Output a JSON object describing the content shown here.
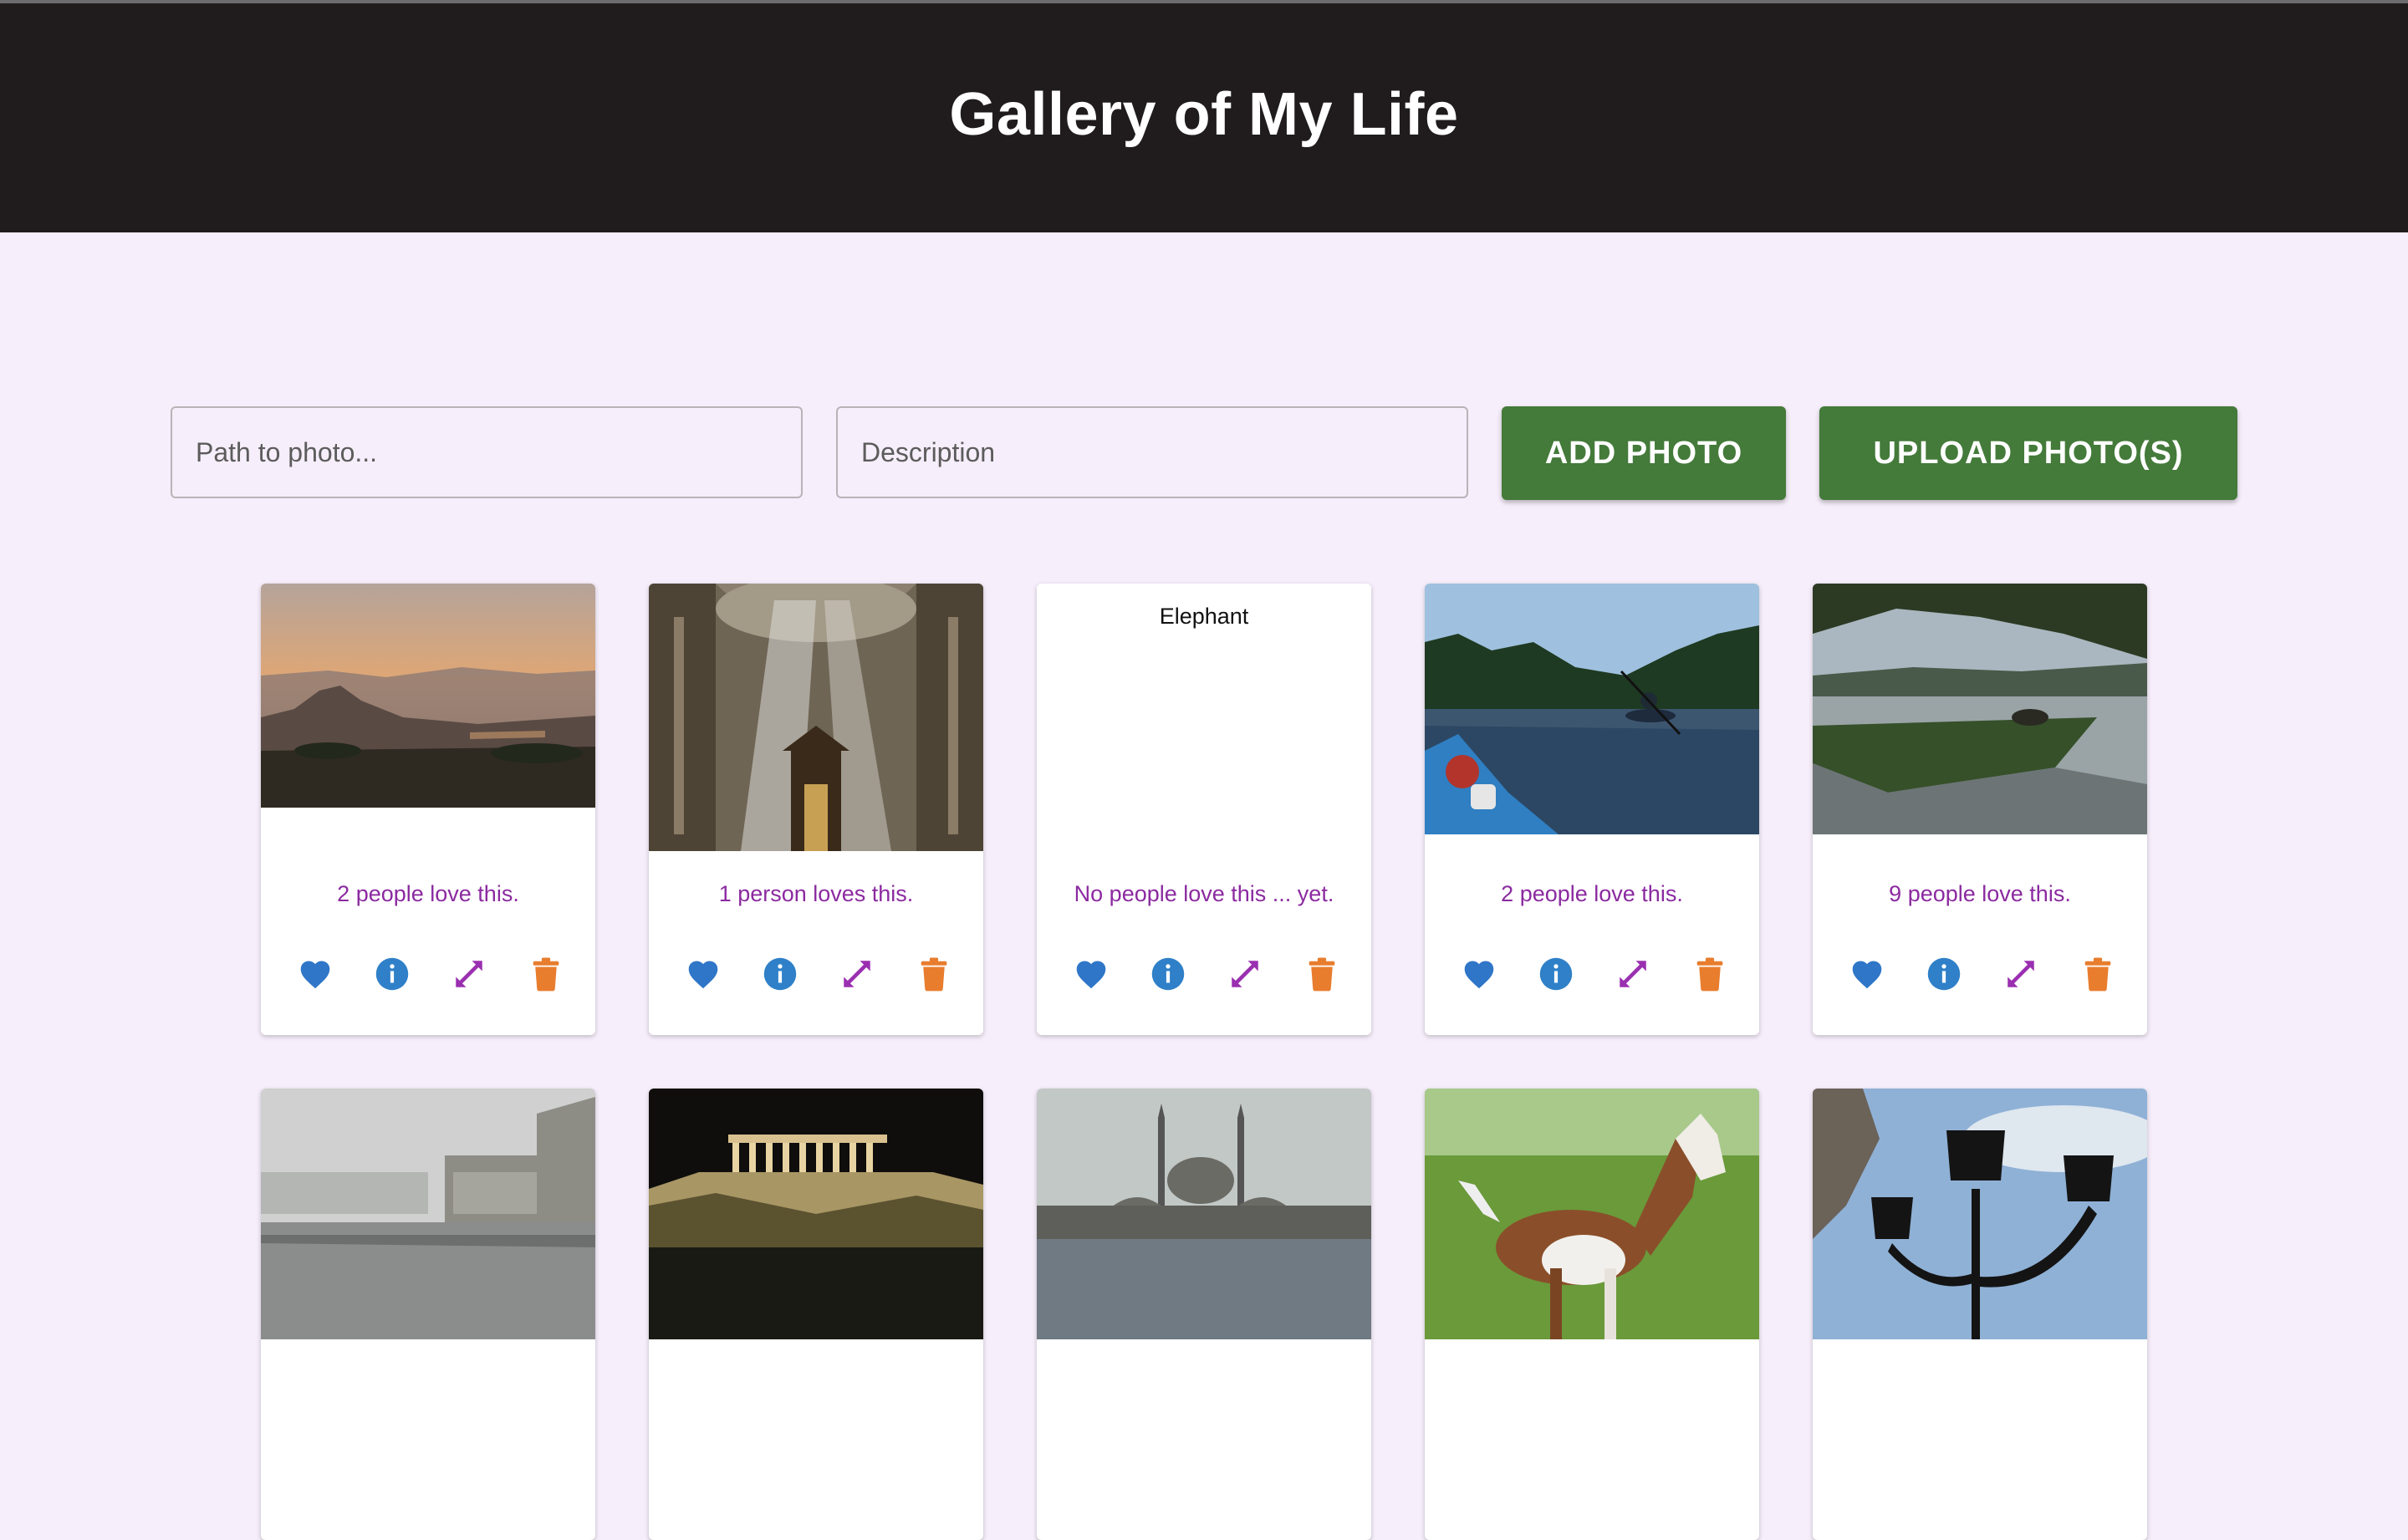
{
  "app": {
    "title": "Gallery of My Life"
  },
  "form": {
    "path_placeholder": "Path to photo...",
    "description_placeholder": "Description",
    "add_label": "ADD PHOTO",
    "upload_label": "UPLOAD PHOTO(S)"
  },
  "colors": {
    "header_bg": "#201c1d",
    "page_bg": "#f6eefa",
    "button_green": "#447a3a",
    "love_text": "#8b2aa0",
    "heart_blue": "#2f76c8",
    "info_blue": "#2f80c8",
    "expand_purple": "#9a2fb0",
    "trash_orange": "#e87d2e"
  },
  "cards": [
    {
      "love": "2 people love this.",
      "icons": [
        "heart-icon",
        "info-icon",
        "expand-icon",
        "trash-icon"
      ]
    },
    {
      "love": "1 person loves this.",
      "icons": [
        "heart-icon",
        "info-icon",
        "expand-icon",
        "trash-icon"
      ]
    },
    {
      "alt": "Elephant",
      "love": "No people love this ... yet.",
      "icons": [
        "heart-icon",
        "info-icon",
        "expand-icon",
        "trash-icon"
      ]
    },
    {
      "love": "2 people love this.",
      "icons": [
        "heart-icon",
        "info-icon",
        "expand-icon",
        "trash-icon"
      ]
    },
    {
      "love": "9 people love this.",
      "icons": [
        "heart-icon",
        "info-icon",
        "expand-icon",
        "trash-icon"
      ]
    },
    {},
    {},
    {},
    {},
    {}
  ]
}
